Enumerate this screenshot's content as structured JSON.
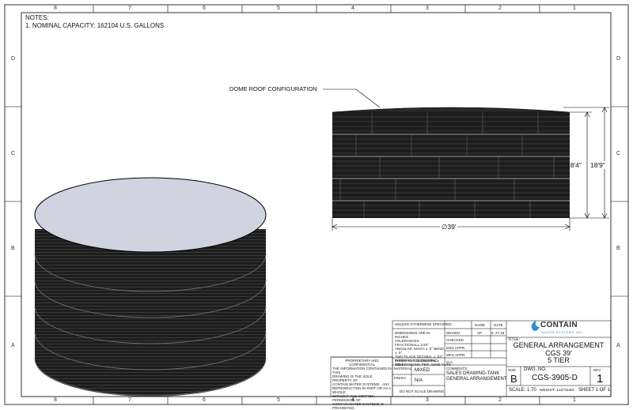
{
  "zones": {
    "columns": [
      "8",
      "7",
      "6",
      "5",
      "4",
      "3",
      "2",
      "1"
    ],
    "rows": [
      "D",
      "C",
      "B",
      "A"
    ]
  },
  "notes": {
    "heading": "NOTES:",
    "item1": "1. NOMINAL CAPACITY: 162104 U.S. GALLONS"
  },
  "callout": {
    "label": "DOME ROOF CONFIGURATION"
  },
  "dimensions": {
    "height_inner": "18'4\"",
    "height_outer": "18'9\"",
    "diameter": "∅39'"
  },
  "title_block": {
    "tolerances": {
      "header": "UNLESS OTHERWISE SPECIFIED:",
      "l1": "DIMENSIONS ARE IN INCHES",
      "l2": "TOLERANCES:",
      "l3": "FRACTIONAL± 1/16\"",
      "l4": "ANGULAR: MACH ± .5° BEND ± .5°",
      "l5": "TWO PLACE DECIMAL  ± .02\"",
      "l6": "THREE PLACE DECIMAL  ± .005\"",
      "l7": "INTERPRET GEOMETRIC",
      "l8": "TOLERANCING PER: ASME Y14.5",
      "material_label": "MATERIAL",
      "material_value": "MIXED",
      "finish_label": "FINISH",
      "finish_value": "N/A",
      "do_not_scale": "DO NOT SCALE DRAWING"
    },
    "proprietary": {
      "header": "PROPRIETARY AND CONFIDENTIAL",
      "l1": "THE INFORMATION CONTAINED IN THIS",
      "l2": "DRAWING IS THE SOLE PROPERTY OF",
      "l3": "CONTAIN WATER SYSTEMS . ANY",
      "l4": "REPRODUCTION IN PART OR AS A WHOLE",
      "l5": "WITHOUT THE WRITTEN PERMISSION OF",
      "l6": "CONTAIN WATER SYSTEMS IS",
      "l7": "PROHIBITED."
    },
    "approvals": {
      "name_header": "NAME",
      "date_header": "DATE",
      "drawn_label": "DRAWN",
      "drawn_name": "AP",
      "drawn_date": "9. 27.18",
      "checked_label": "CHECKED",
      "eng_label": "ENG APPR.",
      "mfg_label": "MFG APPR.",
      "qa_label": "Q.A.",
      "comments_label": "COMMENTS:",
      "comment1": "SALES DRAWING-TANK",
      "comment2": "GENERAL ARRANGEMENT"
    },
    "company": {
      "name": "CONTAIN",
      "sub": "WATER SYSTEMS INC."
    },
    "title": {
      "label": "TITLE:",
      "line1": "GENERAL ARRANGEMENT",
      "line2": "CGS 39'",
      "line3": "5 TIER"
    },
    "size_label": "SIZE",
    "size_value": "B",
    "dwg_label": "DWG.  NO.",
    "dwg_value": "CGS-3905-D",
    "rev_label": "REV",
    "rev_value": "1",
    "scale": "SCALE: 1:70",
    "weight": "WEIGHT: 12272LBS",
    "sheet": "SHEET 1 OF 1"
  },
  "colors": {
    "tank_top": "#d2d3e0",
    "tank_wall": "#1b1b1b",
    "logo_blue": "#2b8fd1",
    "line": "#000000"
  }
}
